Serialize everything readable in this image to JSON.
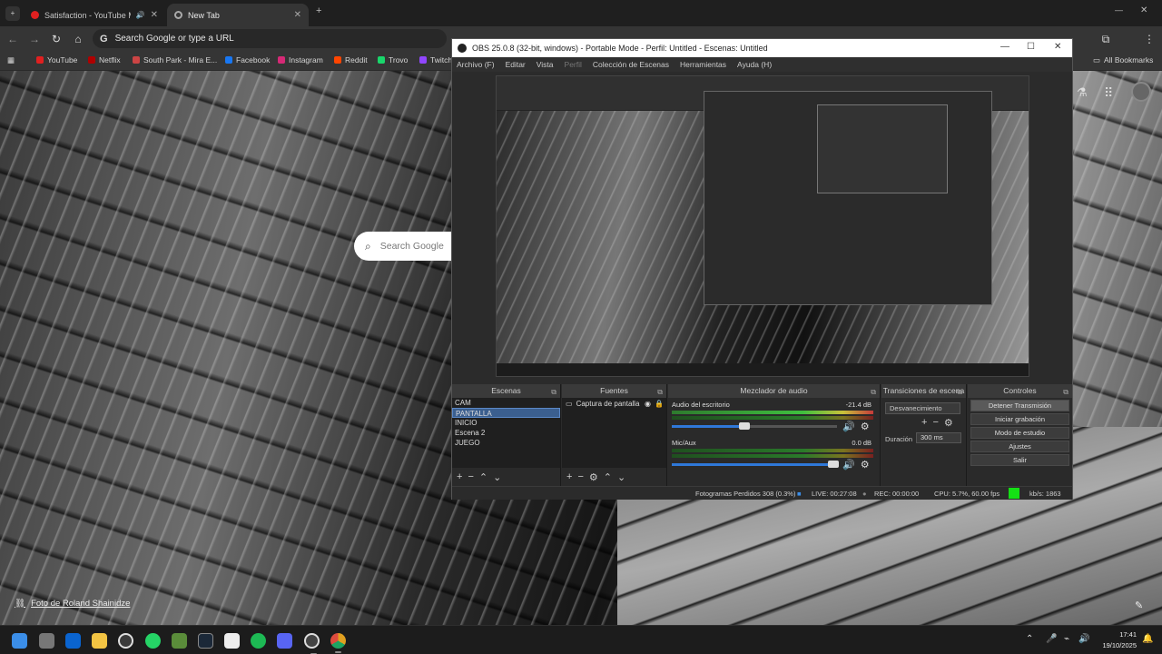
{
  "browser": {
    "tabs": [
      {
        "title": "Satisfaction - YouTube Mu",
        "has_audio": true
      },
      {
        "title": "New Tab",
        "has_audio": false
      }
    ],
    "new_tab_symbol": "+",
    "tab_list_symbol": "⌄",
    "omnibox_text": "Search Google or type a URL",
    "bookmarks": [
      {
        "label": "YouTube",
        "color": "#e02020"
      },
      {
        "label": "Netflix",
        "color": "#b00000"
      },
      {
        "label": "South Park - Mira E...",
        "color": "#c44"
      },
      {
        "label": "Facebook",
        "color": "#1877f2"
      },
      {
        "label": "Instagram",
        "color": "#d62976"
      },
      {
        "label": "Reddit",
        "color": "#ff4500"
      },
      {
        "label": "Trovo",
        "color": "#19d66b"
      },
      {
        "label": "Twitch",
        "color": "#9146ff"
      }
    ],
    "all_bookmarks": "All Bookmarks"
  },
  "newtab": {
    "search_placeholder": "Search Google",
    "photo_credit": "Foto de Roland Shainidze"
  },
  "obs": {
    "title": "OBS 25.0.8 (32-bit, windows) - Portable Mode - Perfil: Untitled - Escenas: Untitled",
    "menu": [
      "Archivo (F)",
      "Editar",
      "Vista",
      "Perfil",
      "Colección de Escenas",
      "Herramientas",
      "Ayuda (H)"
    ],
    "menu_disabled_index": 3,
    "docks": {
      "scenes": {
        "title": "Escenas",
        "items": [
          "CAM",
          "PANTALLA",
          "INICIO",
          "Escena 2",
          "JUEGO"
        ],
        "selected": 1
      },
      "sources": {
        "title": "Fuentes",
        "items": [
          "Captura de pantalla"
        ]
      },
      "mixer": {
        "title": "Mezclador de audio",
        "tracks": [
          {
            "name": "Audio del escritorio",
            "db": "-21.4 dB",
            "volume": 0.46
          },
          {
            "name": "Mic/Aux",
            "db": "0.0 dB",
            "volume": 1.0
          }
        ]
      },
      "transitions": {
        "title": "Transiciones de escena",
        "selected": "Desvanecimiento",
        "duration_label": "Duración",
        "duration_value": "300 ms"
      },
      "controls": {
        "title": "Controles",
        "buttons": [
          "Detener Transmisión",
          "Iniciar grabación",
          "Modo de estudio",
          "Ajustes",
          "Salir"
        ]
      }
    },
    "status": {
      "dropped": "Fotogramas Perdidos 308 (0.3%)",
      "live": "LIVE: 00:27:08",
      "rec": "REC: 00:00:00",
      "cpu": "CPU: 5.7%, 60.00 fps",
      "bitrate": "kb/s: 1863",
      "stream_ok_color": "#14e014"
    }
  },
  "taskbar": {
    "apps": [
      {
        "icon": "windows-start-icon",
        "color": "#3b8ee8"
      },
      {
        "icon": "task-view-icon",
        "color": "#777"
      },
      {
        "icon": "outlook-icon",
        "color": "#0a64d0"
      },
      {
        "icon": "file-explorer-icon",
        "color": "#f3c443"
      },
      {
        "icon": "xbox-icon",
        "color": "#3a3a3a"
      },
      {
        "icon": "whatsapp-icon",
        "color": "#25d366"
      },
      {
        "icon": "minecraft-icon",
        "color": "#5a8c3a"
      },
      {
        "icon": "steam-icon",
        "color": "#1b2838"
      },
      {
        "icon": "notepad-icon",
        "color": "#eee"
      },
      {
        "icon": "spotify-icon",
        "color": "#1db954"
      },
      {
        "icon": "discord-icon",
        "color": "#5865f2"
      },
      {
        "icon": "obs-icon",
        "color": "#444"
      },
      {
        "icon": "chrome-icon",
        "color": "#e0a020"
      }
    ],
    "time": "17:41",
    "date": "19/10/2025"
  }
}
